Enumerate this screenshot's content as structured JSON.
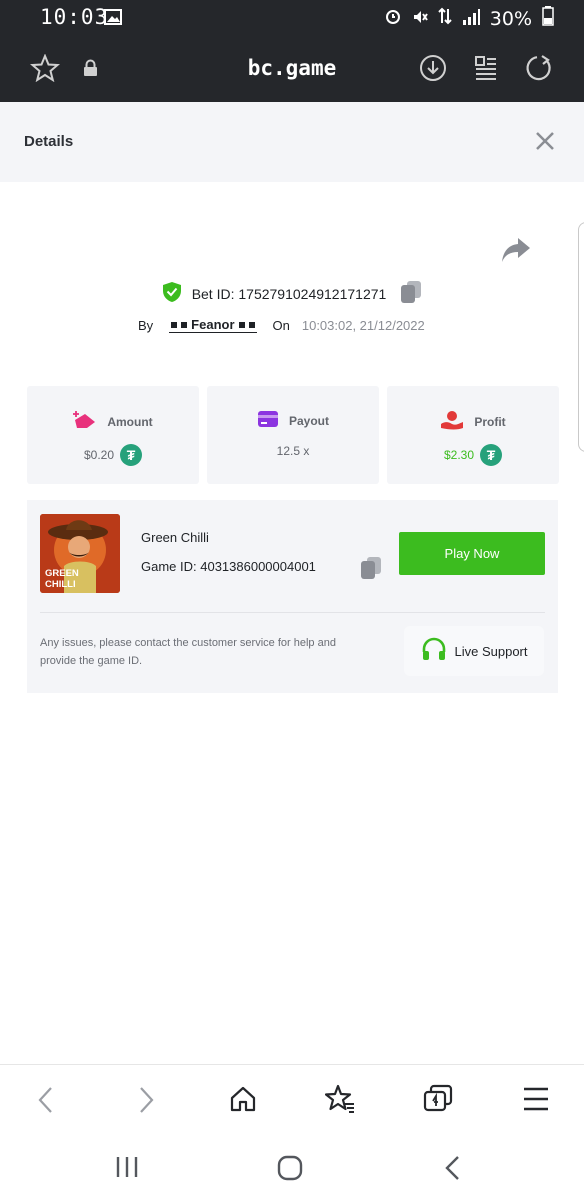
{
  "status": {
    "time": "10:03",
    "battery": "30%"
  },
  "browser": {
    "url": "bc.game"
  },
  "details": {
    "title": "Details",
    "bet_id_label": "Bet ID: 1752791024912171271",
    "by_label": "By",
    "user": "Feanor",
    "on_label": "On",
    "timestamp": "10:03:02, 21/12/2022"
  },
  "cards": [
    {
      "title": "Amount",
      "value": "$0.20",
      "color": "#e8317c"
    },
    {
      "title": "Payout",
      "value": "12.5 x",
      "color": "#8c35e0"
    },
    {
      "title": "Profit",
      "value": "$2.30",
      "color": "#e23939",
      "value_color": "#3cbc1f"
    }
  ],
  "game": {
    "name": "Green Chilli",
    "thumb_text": "GREEN CHILLI",
    "game_id_label": "Game ID: 4031386000004001",
    "play_label": "Play Now",
    "help": "Any issues, please contact the customer service for help and provide the game ID.",
    "support_label": "Live Support"
  },
  "colors": {
    "accent": "#3cbc1f",
    "tether": "#26a17b",
    "topbar": "#25272b"
  }
}
